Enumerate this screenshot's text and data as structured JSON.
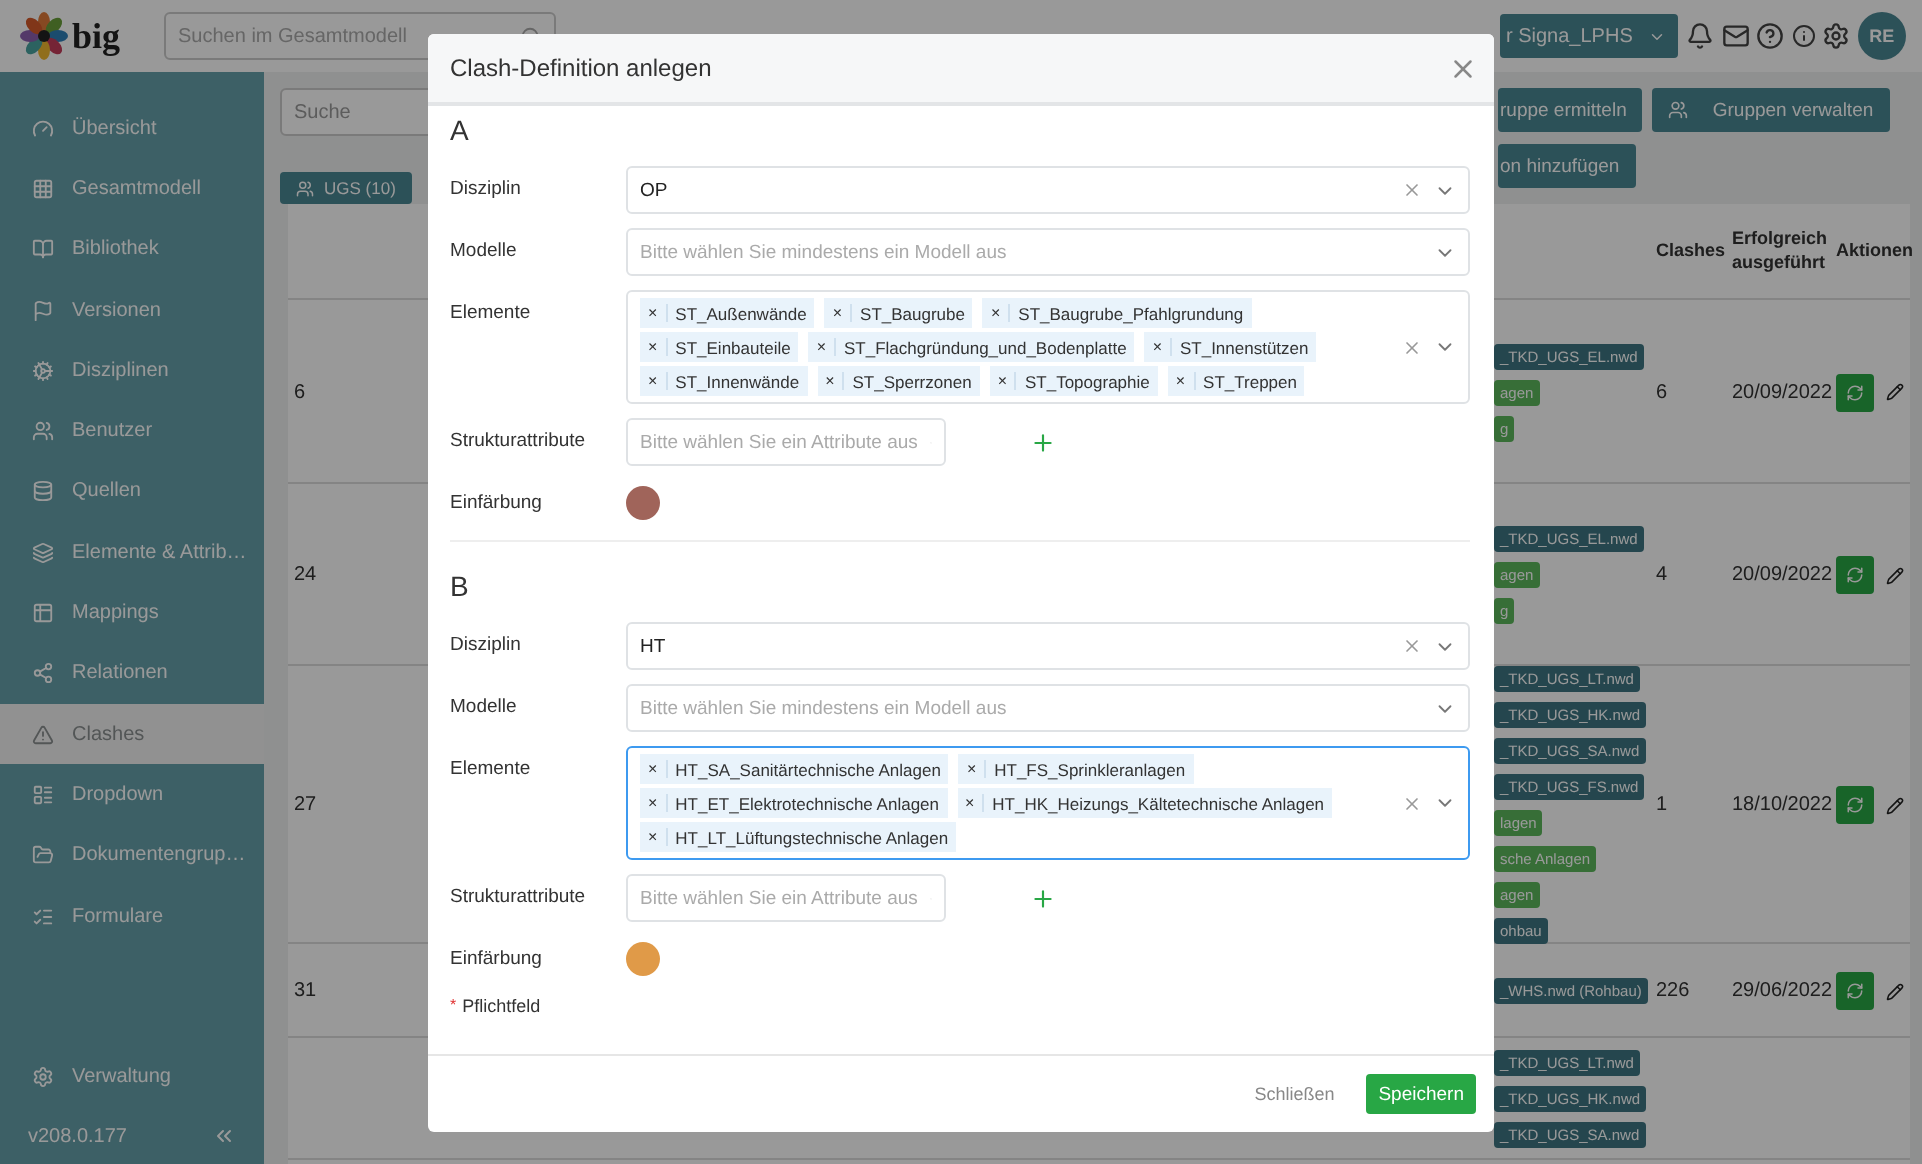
{
  "header": {
    "logo": "big",
    "search_placeholder": "Suchen im Gesamtmodell",
    "project": "r Signa_LPHS",
    "avatar": "RE"
  },
  "sidebar": {
    "items": [
      {
        "label": "Übersicht",
        "selected": false
      },
      {
        "label": "Gesamtmodell",
        "selected": false
      },
      {
        "label": "Bibliothek",
        "selected": false
      },
      {
        "label": "Versionen",
        "selected": false
      },
      {
        "label": "Disziplinen",
        "selected": false
      },
      {
        "label": "Benutzer",
        "selected": false
      },
      {
        "label": "Quellen",
        "selected": false
      },
      {
        "label": "Elemente & Attrib…",
        "selected": false
      },
      {
        "label": "Mappings",
        "selected": false
      },
      {
        "label": "Relationen",
        "selected": false
      },
      {
        "label": "Clashes",
        "selected": true
      },
      {
        "label": "Dropdown",
        "selected": false
      },
      {
        "label": "Dokumentengrup…",
        "selected": false
      },
      {
        "label": "Formulare",
        "selected": false
      }
    ],
    "settings": "Verwaltung",
    "version": "v208.0.177"
  },
  "content": {
    "search_placeholder": "Suche",
    "buttons": [
      "ruppe ermitteln",
      "Gruppen verwalten"
    ],
    "add_button": "on hinzufügen",
    "group_badge": "UGS (10)",
    "table": {
      "columns": [
        "Clashes",
        "Erfolgreich ausgeführt",
        "Aktionen"
      ],
      "rows": [
        {
          "number": "6",
          "tags": [
            {
              "text": "_TKD_UGS_EL.nwd",
              "kind": "model"
            },
            {
              "text": "agen",
              "kind": "element"
            },
            {
              "text": "g",
              "kind": "element"
            }
          ],
          "clashes": "6",
          "date": "20/09/2022"
        },
        {
          "number": "24",
          "tags": [
            {
              "text": "_TKD_UGS_EL.nwd",
              "kind": "model"
            },
            {
              "text": "agen",
              "kind": "element"
            },
            {
              "text": "g",
              "kind": "element"
            }
          ],
          "clashes": "4",
          "date": "20/09/2022"
        },
        {
          "number": "27",
          "tags": [
            {
              "text": "_TKD_UGS_LT.nwd",
              "kind": "model"
            },
            {
              "text": "_TKD_UGS_HK.nwd",
              "kind": "model"
            },
            {
              "text": "_TKD_UGS_SA.nwd",
              "kind": "model"
            },
            {
              "text": "_TKD_UGS_FS.nwd",
              "kind": "model"
            },
            {
              "text": "lagen",
              "kind": "element"
            },
            {
              "text": "sche Anlagen",
              "kind": "element"
            },
            {
              "text": "agen",
              "kind": "element"
            },
            {
              "text": "ohbau",
              "kind": "model"
            }
          ],
          "clashes": "1",
          "date": "18/10/2022"
        },
        {
          "number": "31",
          "tags": [
            {
              "text": "_WHS.nwd (Rohbau)",
              "kind": "model"
            }
          ],
          "clashes": "226",
          "date": "29/06/2022"
        },
        {
          "number": "",
          "tags": [
            {
              "text": "_TKD_UGS_LT.nwd",
              "kind": "model"
            },
            {
              "text": "_TKD_UGS_HK.nwd",
              "kind": "model"
            },
            {
              "text": "_TKD_UGS_SA.nwd",
              "kind": "model"
            }
          ],
          "clashes": "",
          "date": ""
        }
      ]
    }
  },
  "modal": {
    "title": "Clash-Definition anlegen",
    "tag_remove": "×",
    "sections": [
      {
        "heading": "A",
        "fields": {
          "disziplin_label": "Disziplin",
          "disziplin": "OP",
          "modelle_label": "Modelle",
          "modelle_placeholder": "Bitte wählen Sie mindestens ein Modell aus",
          "elemente_label": "Elemente",
          "elemente": [
            "ST_Außenwände",
            "ST_Baugrube",
            "ST_Baugrube_Pfahlgrundung",
            "ST_Einbauteile",
            "ST_Flachgründung_und_Bodenplatte",
            "ST_Innenstützen",
            "ST_Innenwände",
            "ST_Sperrzonen",
            "ST_Topographie",
            "ST_Treppen"
          ],
          "elemente_focused": false,
          "struktur_label": "Strukturattribute",
          "struktur_placeholder": "Bitte wählen Sie ein Attribute aus",
          "farbe_label": "Einfärbung",
          "color": "#a0645a"
        }
      },
      {
        "heading": "B",
        "fields": {
          "disziplin_label": "Disziplin",
          "disziplin": "HT",
          "modelle_label": "Modelle",
          "modelle_placeholder": "Bitte wählen Sie mindestens ein Modell aus",
          "elemente_label": "Elemente",
          "elemente": [
            "HT_SA_Sanitärtechnische Anlagen",
            "HT_FS_Sprinkleranlagen",
            "HT_ET_Elektrotechnische Anlagen",
            "HT_HK_Heizungs_Kältetechnische Anlagen",
            "HT_LT_Lüftungstechnische Anlagen"
          ],
          "elemente_focused": true,
          "struktur_label": "Strukturattribute",
          "struktur_placeholder": "Bitte wählen Sie ein Attribute aus",
          "farbe_label": "Einfärbung",
          "color": "#e09a48"
        }
      }
    ],
    "required_mark": "*",
    "required_note": "Pflichtfeld",
    "close": "Schließen",
    "save": "Speichern"
  }
}
